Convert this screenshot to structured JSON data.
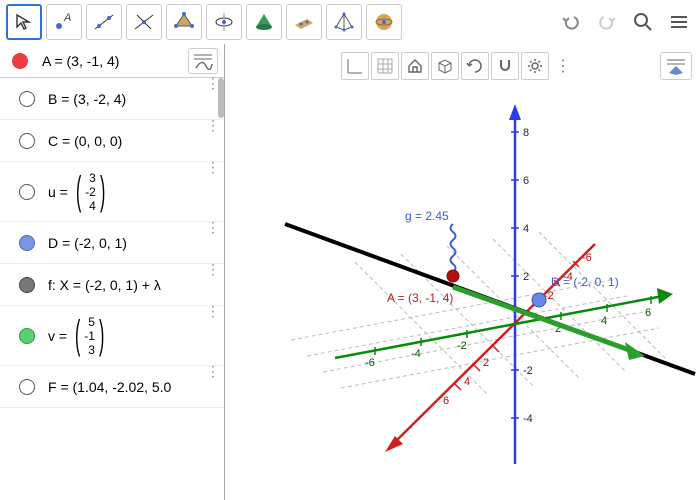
{
  "toolbar": {
    "groups": [
      "move",
      "point",
      "line",
      "perpendicular",
      "polygon",
      "circle",
      "cone",
      "plane",
      "pyramid",
      "sphere"
    ]
  },
  "right_icons": {
    "undo": "↶",
    "redo": "↷",
    "search": "⌕",
    "menu": "≡"
  },
  "algebra": {
    "header": {
      "first_label": "A = (3, -1, 4)"
    },
    "items": [
      {
        "color": "none",
        "label": "B = (3, -2, 4)"
      },
      {
        "color": "none",
        "label": "C = (0, 0, 0)"
      },
      {
        "color": "none",
        "vec": {
          "name": "u",
          "vals": [
            "3",
            "-2",
            "4"
          ]
        }
      },
      {
        "color": "#5a7ee0",
        "label": "D = (-2, 0, 1)"
      },
      {
        "color": "#666",
        "label": "f: X = (-2, 0, 1) + λ"
      },
      {
        "color": "#4ad060",
        "vec": {
          "name": "v",
          "vals": [
            "5",
            "-1",
            "3"
          ]
        }
      },
      {
        "color": "none",
        "label": "F = (1.04, -2.02, 5.0"
      }
    ]
  },
  "graphics_toolbar": [
    "axes",
    "grid",
    "home",
    "cube",
    "reset_rot",
    "snap",
    "settings"
  ],
  "scene": {
    "g_label": "g = 2.45",
    "A_label": "A = (3, -1, 4)",
    "D_label": "D = (-2, 0, 1)",
    "z_ticks": [
      "8",
      "6",
      "4",
      "2",
      "-2",
      "-4"
    ],
    "x_ticks": [
      "-6",
      "-4",
      "-2",
      "2",
      "4",
      "6"
    ],
    "y_ticks": [
      "-6",
      "-4",
      "-2",
      "2",
      "4",
      "6"
    ]
  },
  "chart_data": {
    "type": "scatter",
    "title": "",
    "xlabel": "",
    "ylabel": "",
    "zlabel": "",
    "points": [
      {
        "name": "A",
        "coords": [
          3,
          -1,
          4
        ],
        "color": "#d02020"
      },
      {
        "name": "B",
        "coords": [
          3,
          -2,
          4
        ],
        "color": "#d02020"
      },
      {
        "name": "C",
        "coords": [
          0,
          0,
          0
        ],
        "color": "#d02020"
      },
      {
        "name": "D",
        "coords": [
          -2,
          0,
          1
        ],
        "color": "#5a7ee0"
      },
      {
        "name": "F",
        "coords": [
          1.04,
          -2.02,
          5.0
        ],
        "color": "#888"
      }
    ],
    "vectors": [
      {
        "name": "u",
        "components": [
          3,
          -2,
          4
        ]
      },
      {
        "name": "v",
        "components": [
          5,
          -1,
          3
        ],
        "color": "#2aa02a"
      }
    ],
    "lines": [
      {
        "name": "f",
        "point": [
          -2,
          0,
          1
        ],
        "direction": [
          5,
          -1,
          3
        ],
        "color": "#000"
      },
      {
        "name": "g",
        "value": 2.45,
        "color": "#5a7ee0"
      }
    ],
    "axes_range": {
      "x": [
        -6,
        6
      ],
      "y": [
        -6,
        6
      ],
      "z": [
        -4,
        8
      ]
    }
  }
}
